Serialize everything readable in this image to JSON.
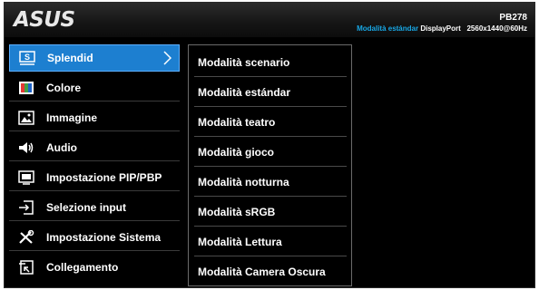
{
  "header": {
    "logo_text": "ASUS",
    "model": "PB278",
    "current_mode": "Modalità estándar",
    "input": "DisplayPort",
    "resolution": "2560x1440@60Hz"
  },
  "main_menu": [
    {
      "label": "Splendid",
      "icon": "splendid-icon",
      "selected": true
    },
    {
      "label": "Colore",
      "icon": "color-icon"
    },
    {
      "label": "Immagine",
      "icon": "image-icon"
    },
    {
      "label": "Audio",
      "icon": "speaker-icon"
    },
    {
      "label": "Impostazione PIP/PBP",
      "icon": "pip-icon"
    },
    {
      "label": "Selezione input",
      "icon": "input-select-icon"
    },
    {
      "label": "Impostazione Sistema",
      "icon": "system-settings-icon"
    },
    {
      "label": "Collegamento",
      "icon": "shortcut-icon"
    }
  ],
  "submenu": [
    "Modalità scenario",
    "Modalità estándar",
    "Modalità teatro",
    "Modalità gioco",
    "Modalità notturna",
    "Modalità sRGB",
    "Modalità Lettura",
    "Modalità Camera Oscura"
  ],
  "colors": {
    "accent": "#1d7fd0",
    "status_blue": "#18a8e6"
  }
}
